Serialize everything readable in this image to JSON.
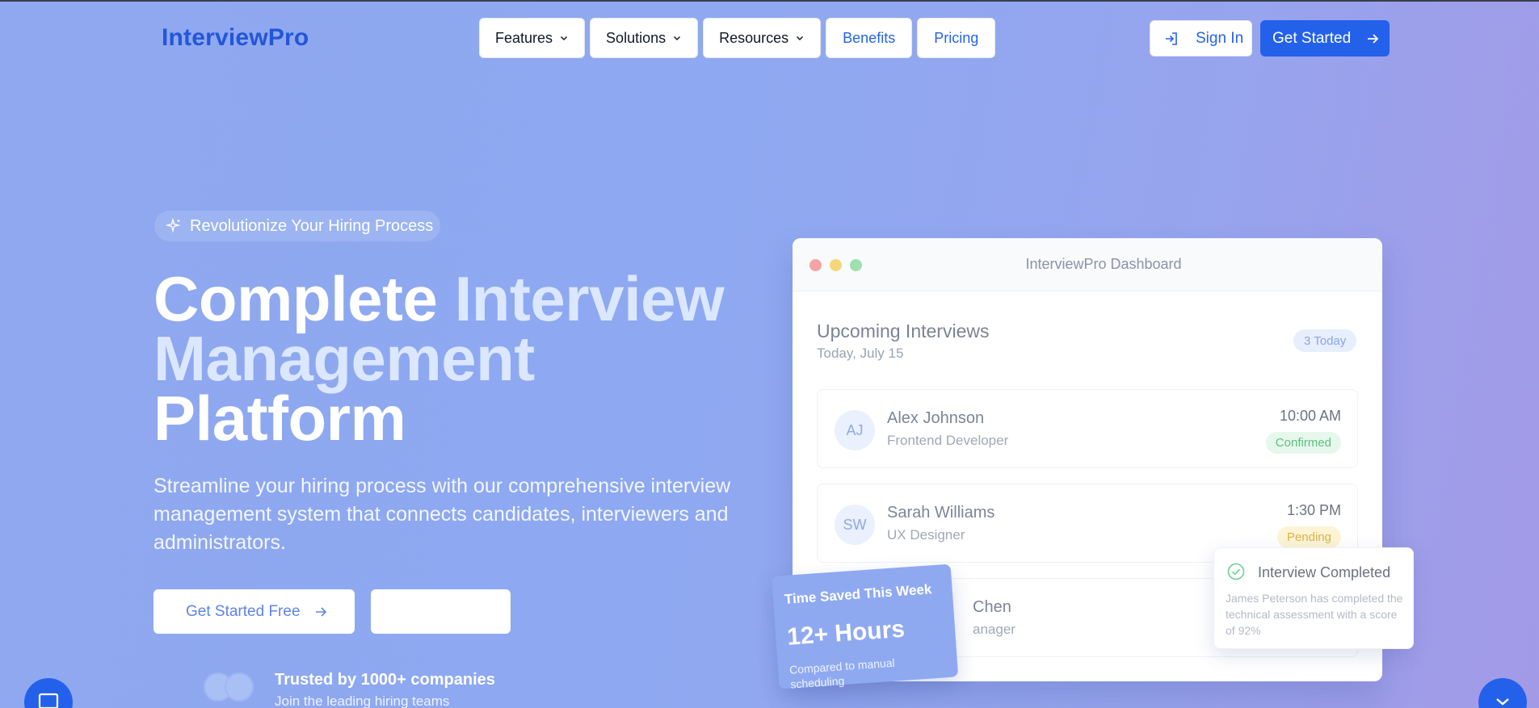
{
  "header": {
    "logo": "InterviewPro",
    "nav": [
      {
        "label": "Features",
        "dropdown": true
      },
      {
        "label": "Solutions",
        "dropdown": true
      },
      {
        "label": "Resources",
        "dropdown": true
      },
      {
        "label": "Benefits",
        "dropdown": false
      },
      {
        "label": "Pricing",
        "dropdown": false
      }
    ],
    "signin_label": "Sign In",
    "get_started_label": "Get Started"
  },
  "hero": {
    "pill": "Revolutionize Your Hiring Process",
    "headline_part1": "Complete",
    "headline_part2": "Interview",
    "headline_part3": "Management",
    "headline_part4": "Platform",
    "subtitle": "Streamline your hiring process with our comprehensive interview management system that connects candidates, interviewers and administrators.",
    "cta_primary": "Get Started Free",
    "cta_secondary": "",
    "trust_title": "Trusted by 1000+ companies",
    "trust_sub": "Join the leading hiring teams"
  },
  "dashboard": {
    "window_title": "InterviewPro Dashboard",
    "heading": "Upcoming Interviews",
    "date": "Today, July 15",
    "badge": "3 Today",
    "interviews": [
      {
        "initials": "AJ",
        "name": "Alex Johnson",
        "role": "Frontend Developer",
        "time": "10:00 AM",
        "status": "Confirmed"
      },
      {
        "initials": "SW",
        "name": "Sarah Williams",
        "role": "UX Designer",
        "time": "1:30 PM",
        "status": "Pending"
      },
      {
        "initials": "",
        "name": "Chen",
        "role": "anager",
        "time": "",
        "status": ""
      }
    ]
  },
  "toast": {
    "title": "Interview Completed",
    "text": "James Peterson has completed the technical assessment with a score of 92%"
  },
  "time_saved": {
    "title": "Time Saved This Week",
    "value": "12+ Hours",
    "subtitle": "Compared to manual scheduling"
  },
  "colors": {
    "brand": "#2461eb",
    "confirmed_bg": "#e6f7ec",
    "confirmed_fg": "#5fbf7f",
    "pending_bg": "#fdf4d6",
    "pending_fg": "#d9b34a"
  },
  "icons": {
    "pill": "sparkles-icon",
    "signin": "login-icon",
    "arrow": "arrow-right-icon",
    "toast": "check-circle-icon",
    "chat": "chat-icon",
    "scroll": "chevron-down-icon"
  }
}
